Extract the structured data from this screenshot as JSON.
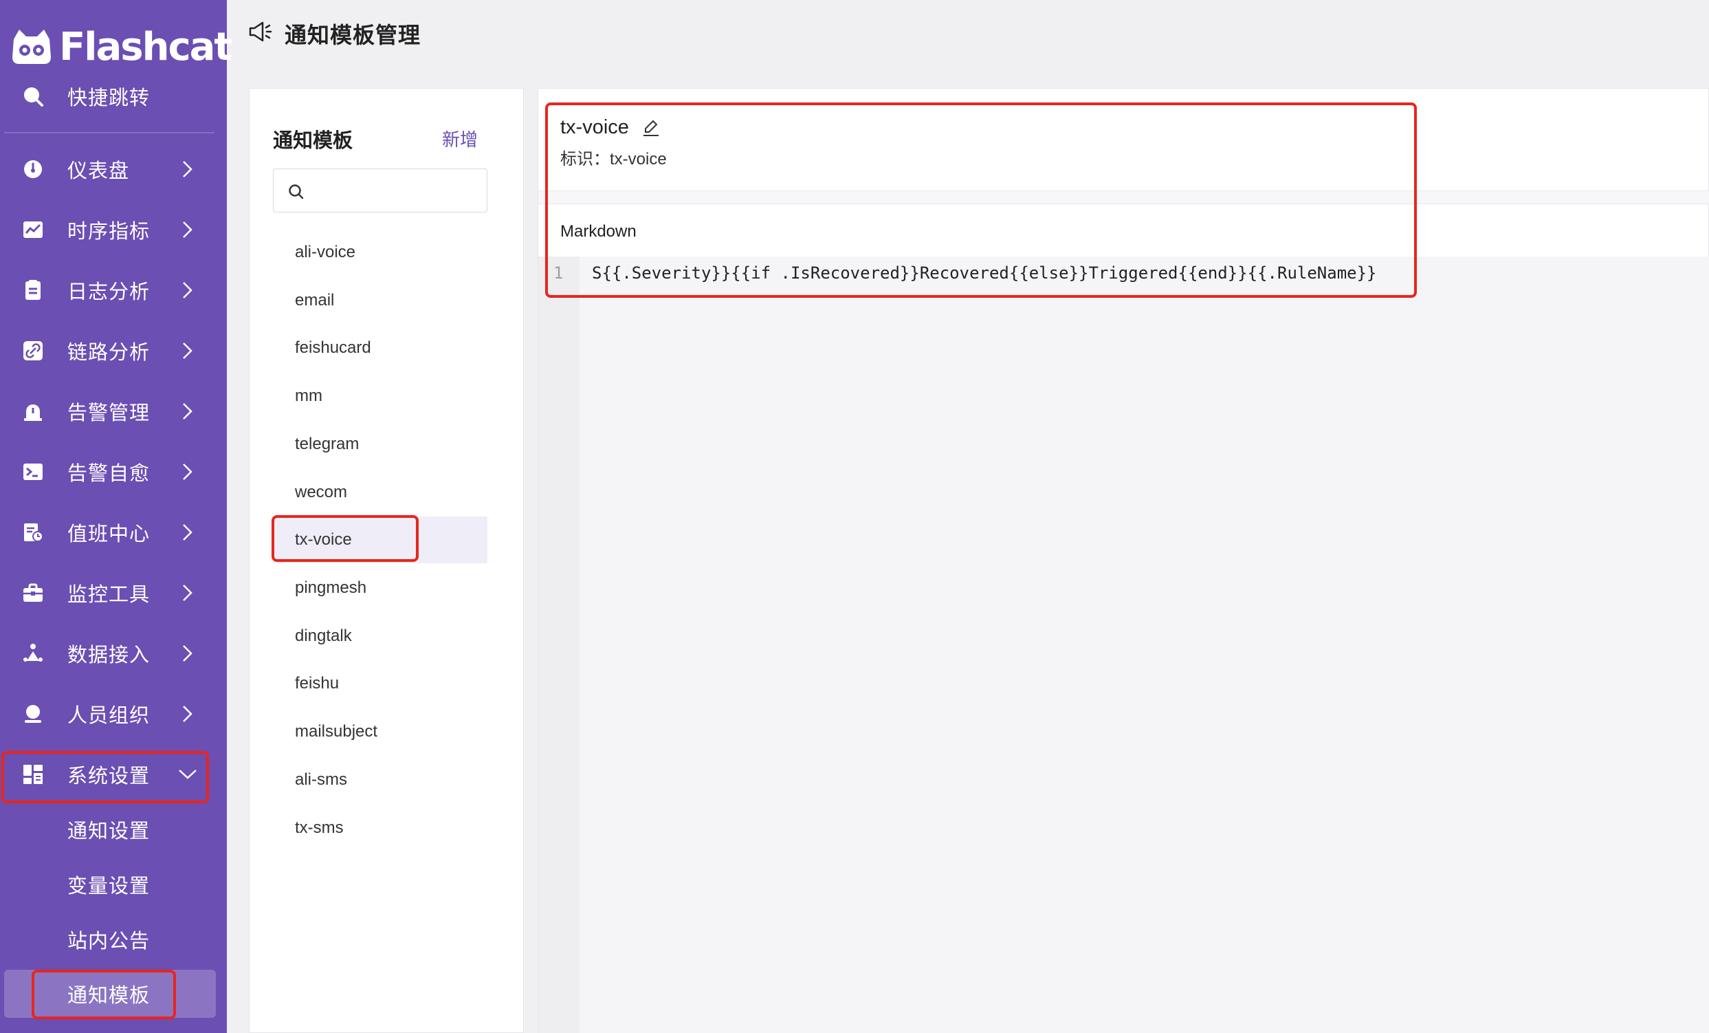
{
  "app": {
    "brand": "Flashcat",
    "accent": "#6b4fb3",
    "highlight": "#e8261c"
  },
  "sidebar": {
    "quick_jump": {
      "label": "快捷跳转",
      "icon": "search-icon"
    },
    "items": [
      {
        "label": "仪表盘",
        "icon": "dashboard-icon"
      },
      {
        "label": "时序指标",
        "icon": "line-chart-icon"
      },
      {
        "label": "日志分析",
        "icon": "log-icon"
      },
      {
        "label": "链路分析",
        "icon": "link-icon"
      },
      {
        "label": "告警管理",
        "icon": "alarm-icon"
      },
      {
        "label": "告警自愈",
        "icon": "terminal-icon"
      },
      {
        "label": "值班中心",
        "icon": "duty-icon"
      },
      {
        "label": "监控工具",
        "icon": "toolbox-icon"
      },
      {
        "label": "数据接入",
        "icon": "data-icon"
      },
      {
        "label": "人员组织",
        "icon": "user-icon"
      },
      {
        "label": "系统设置",
        "icon": "settings-grid-icon",
        "expanded": true
      }
    ],
    "sub_items": [
      {
        "label": "通知设置"
      },
      {
        "label": "变量设置"
      },
      {
        "label": "站内公告"
      },
      {
        "label": "通知模板",
        "active": true
      }
    ]
  },
  "header": {
    "title": "通知模板管理",
    "icon": "megaphone-icon"
  },
  "template_list": {
    "title": "通知模板",
    "add_label": "新增",
    "search_placeholder": "",
    "items": [
      "ali-voice",
      "email",
      "feishucard",
      "mm",
      "telegram",
      "wecom",
      "tx-voice",
      "pingmesh",
      "dingtalk",
      "feishu",
      "mailsubject",
      "ali-sms",
      "tx-sms"
    ],
    "selected": "tx-voice"
  },
  "editor": {
    "name": "tx-voice",
    "identifier_label": "标识：",
    "identifier": "tx-voice",
    "field_label": "Markdown",
    "line_number": "1",
    "code": "S{{.Severity}}{{if .IsRecovered}}Recovered{{else}}Triggered{{end}}{{.RuleName}}"
  }
}
